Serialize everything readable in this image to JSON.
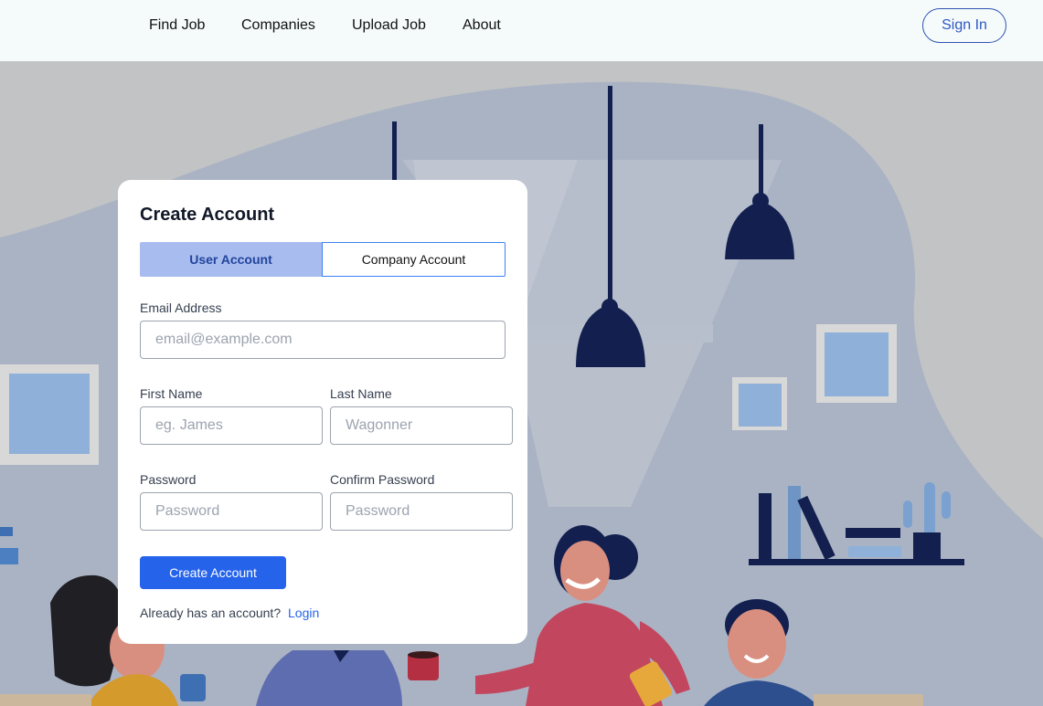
{
  "nav": {
    "links": [
      "Find Job",
      "Companies",
      "Upload Job",
      "About"
    ],
    "sign_in": "Sign In"
  },
  "form": {
    "title": "Create Account",
    "tabs": {
      "user": "User Account",
      "company": "Company Account"
    },
    "email": {
      "label": "Email Address",
      "placeholder": "email@example.com"
    },
    "first_name": {
      "label": "First Name",
      "placeholder": "eg. James"
    },
    "last_name": {
      "label": "Last Name",
      "placeholder": "Wagonner"
    },
    "password": {
      "label": "Password",
      "placeholder": "Password"
    },
    "confirm_password": {
      "label": "Confirm Password",
      "placeholder": "Password"
    },
    "submit": "Create Account",
    "already_text": "Already has an account?",
    "login_link": "Login"
  },
  "colors": {
    "accent": "#2563eb",
    "active_tab": "#a9bcf0",
    "lamp": "#13204f"
  }
}
